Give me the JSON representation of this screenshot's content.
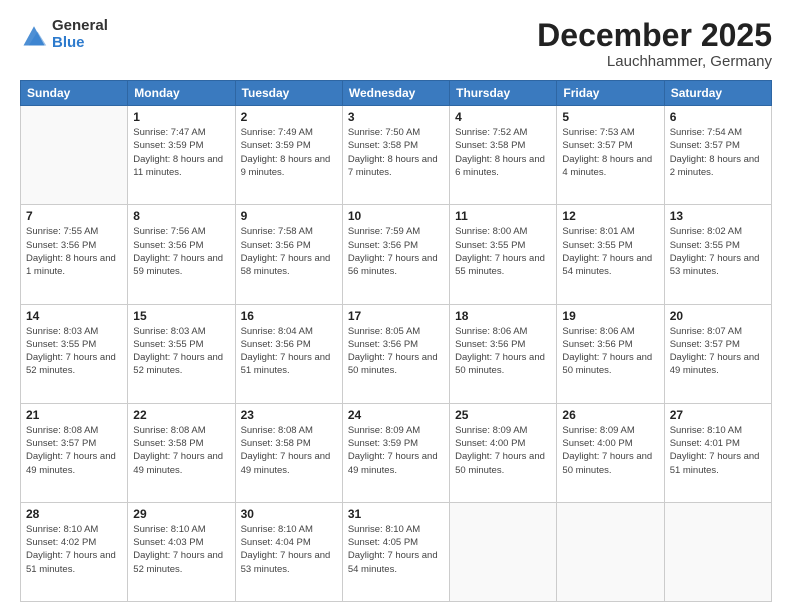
{
  "logo": {
    "general": "General",
    "blue": "Blue"
  },
  "header": {
    "month": "December 2025",
    "location": "Lauchhammer, Germany"
  },
  "weekdays": [
    "Sunday",
    "Monday",
    "Tuesday",
    "Wednesday",
    "Thursday",
    "Friday",
    "Saturday"
  ],
  "weeks": [
    [
      {
        "day": "",
        "sunrise": "",
        "sunset": "",
        "daylight": ""
      },
      {
        "day": "1",
        "sunrise": "Sunrise: 7:47 AM",
        "sunset": "Sunset: 3:59 PM",
        "daylight": "Daylight: 8 hours and 11 minutes."
      },
      {
        "day": "2",
        "sunrise": "Sunrise: 7:49 AM",
        "sunset": "Sunset: 3:59 PM",
        "daylight": "Daylight: 8 hours and 9 minutes."
      },
      {
        "day": "3",
        "sunrise": "Sunrise: 7:50 AM",
        "sunset": "Sunset: 3:58 PM",
        "daylight": "Daylight: 8 hours and 7 minutes."
      },
      {
        "day": "4",
        "sunrise": "Sunrise: 7:52 AM",
        "sunset": "Sunset: 3:58 PM",
        "daylight": "Daylight: 8 hours and 6 minutes."
      },
      {
        "day": "5",
        "sunrise": "Sunrise: 7:53 AM",
        "sunset": "Sunset: 3:57 PM",
        "daylight": "Daylight: 8 hours and 4 minutes."
      },
      {
        "day": "6",
        "sunrise": "Sunrise: 7:54 AM",
        "sunset": "Sunset: 3:57 PM",
        "daylight": "Daylight: 8 hours and 2 minutes."
      }
    ],
    [
      {
        "day": "7",
        "sunrise": "Sunrise: 7:55 AM",
        "sunset": "Sunset: 3:56 PM",
        "daylight": "Daylight: 8 hours and 1 minute."
      },
      {
        "day": "8",
        "sunrise": "Sunrise: 7:56 AM",
        "sunset": "Sunset: 3:56 PM",
        "daylight": "Daylight: 7 hours and 59 minutes."
      },
      {
        "day": "9",
        "sunrise": "Sunrise: 7:58 AM",
        "sunset": "Sunset: 3:56 PM",
        "daylight": "Daylight: 7 hours and 58 minutes."
      },
      {
        "day": "10",
        "sunrise": "Sunrise: 7:59 AM",
        "sunset": "Sunset: 3:56 PM",
        "daylight": "Daylight: 7 hours and 56 minutes."
      },
      {
        "day": "11",
        "sunrise": "Sunrise: 8:00 AM",
        "sunset": "Sunset: 3:55 PM",
        "daylight": "Daylight: 7 hours and 55 minutes."
      },
      {
        "day": "12",
        "sunrise": "Sunrise: 8:01 AM",
        "sunset": "Sunset: 3:55 PM",
        "daylight": "Daylight: 7 hours and 54 minutes."
      },
      {
        "day": "13",
        "sunrise": "Sunrise: 8:02 AM",
        "sunset": "Sunset: 3:55 PM",
        "daylight": "Daylight: 7 hours and 53 minutes."
      }
    ],
    [
      {
        "day": "14",
        "sunrise": "Sunrise: 8:03 AM",
        "sunset": "Sunset: 3:55 PM",
        "daylight": "Daylight: 7 hours and 52 minutes."
      },
      {
        "day": "15",
        "sunrise": "Sunrise: 8:03 AM",
        "sunset": "Sunset: 3:55 PM",
        "daylight": "Daylight: 7 hours and 52 minutes."
      },
      {
        "day": "16",
        "sunrise": "Sunrise: 8:04 AM",
        "sunset": "Sunset: 3:56 PM",
        "daylight": "Daylight: 7 hours and 51 minutes."
      },
      {
        "day": "17",
        "sunrise": "Sunrise: 8:05 AM",
        "sunset": "Sunset: 3:56 PM",
        "daylight": "Daylight: 7 hours and 50 minutes."
      },
      {
        "day": "18",
        "sunrise": "Sunrise: 8:06 AM",
        "sunset": "Sunset: 3:56 PM",
        "daylight": "Daylight: 7 hours and 50 minutes."
      },
      {
        "day": "19",
        "sunrise": "Sunrise: 8:06 AM",
        "sunset": "Sunset: 3:56 PM",
        "daylight": "Daylight: 7 hours and 50 minutes."
      },
      {
        "day": "20",
        "sunrise": "Sunrise: 8:07 AM",
        "sunset": "Sunset: 3:57 PM",
        "daylight": "Daylight: 7 hours and 49 minutes."
      }
    ],
    [
      {
        "day": "21",
        "sunrise": "Sunrise: 8:08 AM",
        "sunset": "Sunset: 3:57 PM",
        "daylight": "Daylight: 7 hours and 49 minutes."
      },
      {
        "day": "22",
        "sunrise": "Sunrise: 8:08 AM",
        "sunset": "Sunset: 3:58 PM",
        "daylight": "Daylight: 7 hours and 49 minutes."
      },
      {
        "day": "23",
        "sunrise": "Sunrise: 8:08 AM",
        "sunset": "Sunset: 3:58 PM",
        "daylight": "Daylight: 7 hours and 49 minutes."
      },
      {
        "day": "24",
        "sunrise": "Sunrise: 8:09 AM",
        "sunset": "Sunset: 3:59 PM",
        "daylight": "Daylight: 7 hours and 49 minutes."
      },
      {
        "day": "25",
        "sunrise": "Sunrise: 8:09 AM",
        "sunset": "Sunset: 4:00 PM",
        "daylight": "Daylight: 7 hours and 50 minutes."
      },
      {
        "day": "26",
        "sunrise": "Sunrise: 8:09 AM",
        "sunset": "Sunset: 4:00 PM",
        "daylight": "Daylight: 7 hours and 50 minutes."
      },
      {
        "day": "27",
        "sunrise": "Sunrise: 8:10 AM",
        "sunset": "Sunset: 4:01 PM",
        "daylight": "Daylight: 7 hours and 51 minutes."
      }
    ],
    [
      {
        "day": "28",
        "sunrise": "Sunrise: 8:10 AM",
        "sunset": "Sunset: 4:02 PM",
        "daylight": "Daylight: 7 hours and 51 minutes."
      },
      {
        "day": "29",
        "sunrise": "Sunrise: 8:10 AM",
        "sunset": "Sunset: 4:03 PM",
        "daylight": "Daylight: 7 hours and 52 minutes."
      },
      {
        "day": "30",
        "sunrise": "Sunrise: 8:10 AM",
        "sunset": "Sunset: 4:04 PM",
        "daylight": "Daylight: 7 hours and 53 minutes."
      },
      {
        "day": "31",
        "sunrise": "Sunrise: 8:10 AM",
        "sunset": "Sunset: 4:05 PM",
        "daylight": "Daylight: 7 hours and 54 minutes."
      },
      {
        "day": "",
        "sunrise": "",
        "sunset": "",
        "daylight": ""
      },
      {
        "day": "",
        "sunrise": "",
        "sunset": "",
        "daylight": ""
      },
      {
        "day": "",
        "sunrise": "",
        "sunset": "",
        "daylight": ""
      }
    ]
  ]
}
